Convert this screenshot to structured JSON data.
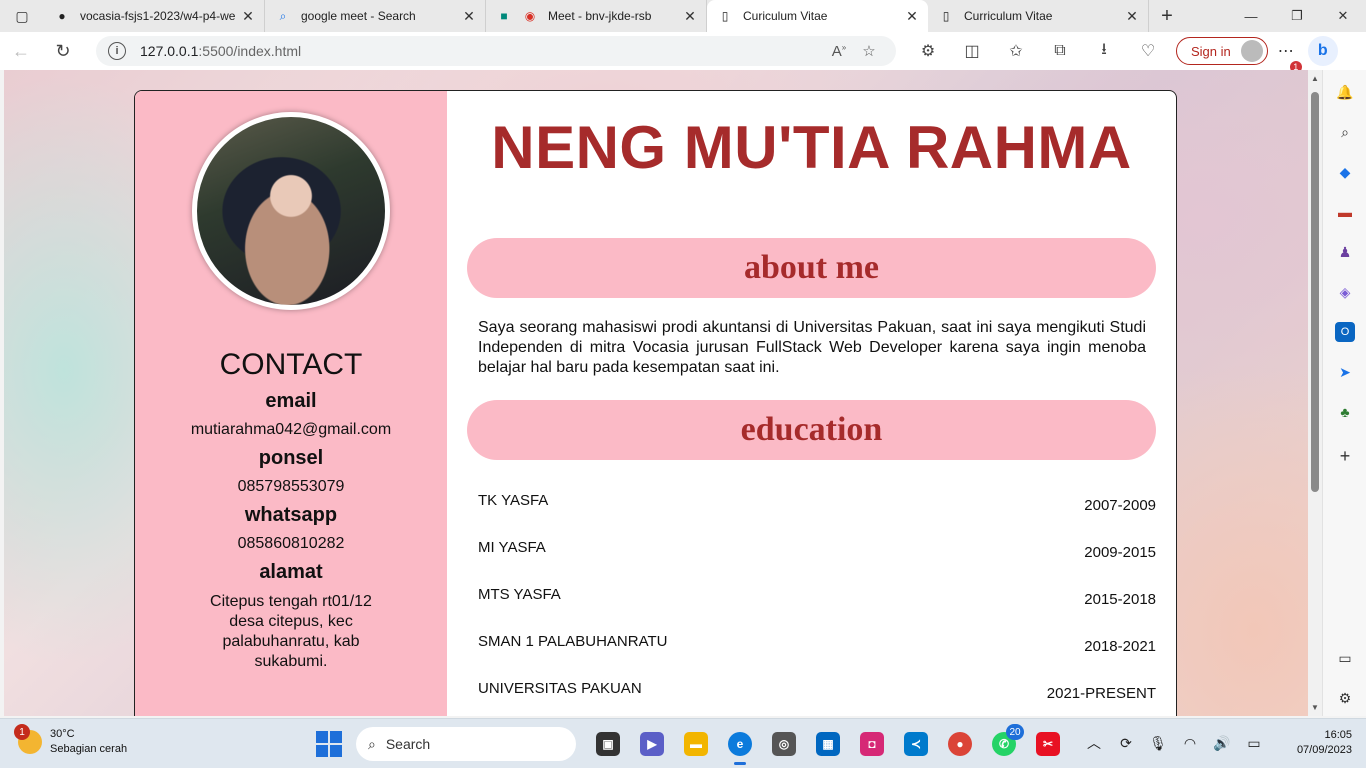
{
  "tabs": [
    {
      "title": "vocasia-fsjs1-2023/w4-p4-we",
      "icon": "github-icon",
      "active": false
    },
    {
      "title": "google meet - Search",
      "icon": "search-icon",
      "active": false
    },
    {
      "title": "Meet - bnv-jkde-rsb",
      "icon": "meet-icon",
      "active": false
    },
    {
      "title": "Curiculum Vitae",
      "icon": "page-icon",
      "active": true
    },
    {
      "title": "Curriculum Vitae",
      "icon": "page-icon",
      "active": false
    }
  ],
  "address": {
    "host": "127.0.0.1",
    "path": ":5500/index.html"
  },
  "toolbar": {
    "signin_label": "Sign in",
    "notif_count": "1"
  },
  "cv": {
    "name": "NENG MU'TIA RAHMA",
    "contact_title": "CONTACT",
    "email_label": "email",
    "email": "mutiarahma042@gmail.com",
    "ponsel_label": "ponsel",
    "ponsel": "085798553079",
    "whatsapp_label": "whatsapp",
    "whatsapp": "085860810282",
    "alamat_label": "alamat",
    "alamat": "Citepus tengah rt01/12 desa citepus, kec palabuhanratu, kab sukabumi.",
    "about_title": "about me",
    "about_text": "Saya seorang mahasiswi prodi akuntansi di Universitas Pakuan, saat ini saya mengikuti Studi Independen di mitra Vocasia jurusan FullStack Web Developer karena saya ingin menoba belajar hal baru pada kesempatan saat ini.",
    "education_title": "education",
    "education": [
      {
        "school": "TK YASFA",
        "years": "2007-2009"
      },
      {
        "school": "MI YASFA",
        "years": "2009-2015"
      },
      {
        "school": "MTS YASFA",
        "years": "2015-2018"
      },
      {
        "school": "SMAN 1 PALABUHANRATU",
        "years": "2018-2021"
      },
      {
        "school": "UNIVERSITAS PAKUAN",
        "years": "2021-PRESENT"
      }
    ]
  },
  "taskbar": {
    "temperature": "30°C",
    "weather": "Sebagian cerah",
    "weather_badge": "1",
    "search_label": "Search",
    "whatsapp_badge": "20",
    "time": "16:05",
    "date": "07/09/2023"
  }
}
